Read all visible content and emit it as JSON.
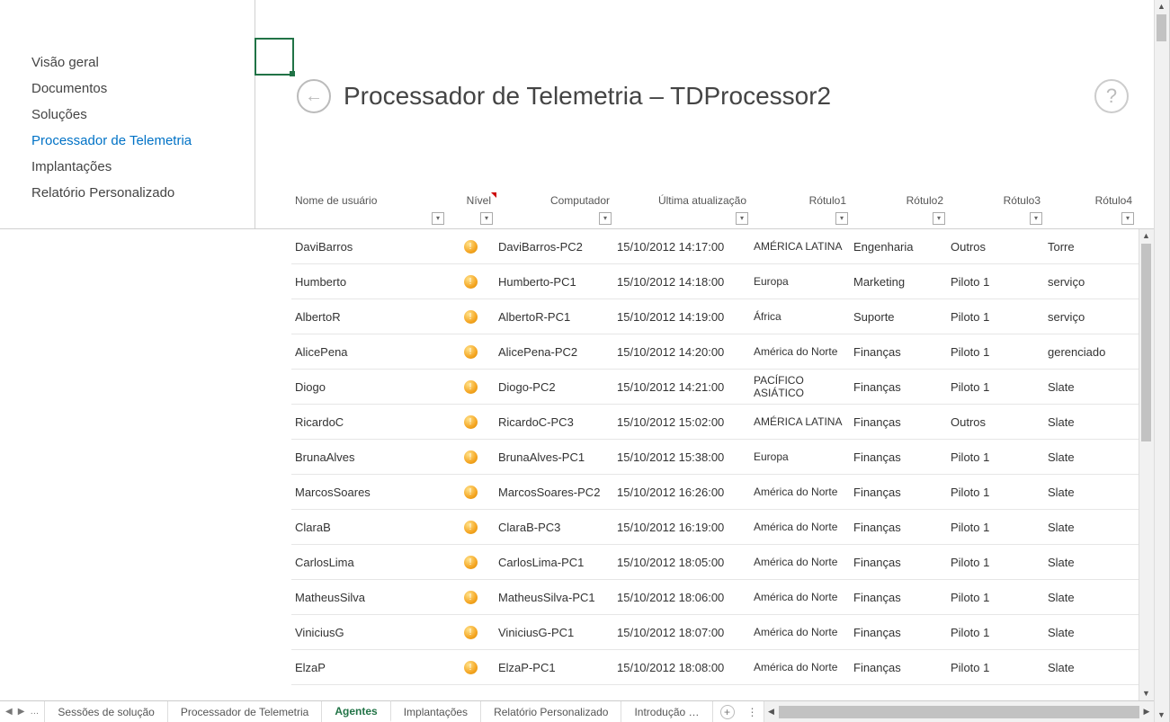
{
  "sidebar": {
    "items": [
      {
        "label": "Visão geral"
      },
      {
        "label": "Documentos"
      },
      {
        "label": "Soluções"
      },
      {
        "label": "Processador de Telemetria",
        "active": true
      },
      {
        "label": "Implantações"
      },
      {
        "label": "Relatório Personalizado"
      }
    ]
  },
  "header": {
    "title": "Processador de Telemetria – TDProcessor2"
  },
  "columns": [
    {
      "label": "Nome de usuário"
    },
    {
      "label": "Nível",
      "redmark": true
    },
    {
      "label": "Computador"
    },
    {
      "label": "Última atualização"
    },
    {
      "label": "Rótulo1"
    },
    {
      "label": "Rótulo2"
    },
    {
      "label": "Rótulo3"
    },
    {
      "label": "Rótulo4"
    }
  ],
  "rows": [
    {
      "user": "DaviBarros",
      "computer": "DaviBarros-PC2",
      "updated": "15/10/2012 14:17:00",
      "r1": "AMÉRICA LATINA",
      "r2": "Engenharia",
      "r3": "Outros",
      "r4": "Torre"
    },
    {
      "user": "Humberto",
      "computer": "Humberto-PC1",
      "updated": "15/10/2012 14:18:00",
      "r1": "Europa",
      "r2": "Marketing",
      "r3": "Piloto 1",
      "r4": "serviço"
    },
    {
      "user": "AlbertoR",
      "computer": "AlbertoR-PC1",
      "updated": "15/10/2012 14:19:00",
      "r1": "África",
      "r2": "Suporte",
      "r3": "Piloto 1",
      "r4": "serviço"
    },
    {
      "user": "AlicePena",
      "computer": "AlicePena-PC2",
      "updated": "15/10/2012 14:20:00",
      "r1": "América do Norte",
      "r2": "Finanças",
      "r3": "Piloto 1",
      "r4": "gerenciado"
    },
    {
      "user": "Diogo",
      "computer": "Diogo-PC2",
      "updated": "15/10/2012 14:21:00",
      "r1": "PACÍFICO ASIÁTICO",
      "r2": "Finanças",
      "r3": "Piloto 1",
      "r4": "Slate"
    },
    {
      "user": "RicardoC",
      "computer": "RicardoC-PC3",
      "updated": "15/10/2012 15:02:00",
      "r1": "AMÉRICA LATINA",
      "r2": "Finanças",
      "r3": "Outros",
      "r4": "Slate"
    },
    {
      "user": "BrunaAlves",
      "computer": "BrunaAlves-PC1",
      "updated": "15/10/2012 15:38:00",
      "r1": "Europa",
      "r2": "Finanças",
      "r3": "Piloto 1",
      "r4": "Slate"
    },
    {
      "user": "MarcosSoares",
      "computer": "MarcosSoares-PC2",
      "updated": "15/10/2012 16:26:00",
      "r1": "América do Norte",
      "r2": "Finanças",
      "r3": "Piloto 1",
      "r4": "Slate"
    },
    {
      "user": "ClaraB",
      "computer": "ClaraB-PC3",
      "updated": "15/10/2012 16:19:00",
      "r1": "América do Norte",
      "r2": "Finanças",
      "r3": "Piloto 1",
      "r4": "Slate"
    },
    {
      "user": "CarlosLima",
      "computer": "CarlosLima-PC1",
      "updated": "15/10/2012 18:05:00",
      "r1": "América do Norte",
      "r2": "Finanças",
      "r3": "Piloto 1",
      "r4": "Slate"
    },
    {
      "user": "MatheusSilva",
      "computer": "MatheusSilva-PC1",
      "updated": "15/10/2012 18:06:00",
      "r1": "América do Norte",
      "r2": "Finanças",
      "r3": "Piloto 1",
      "r4": "Slate"
    },
    {
      "user": "ViniciusG",
      "computer": "ViniciusG-PC1",
      "updated": "15/10/2012 18:07:00",
      "r1": "América do Norte",
      "r2": "Finanças",
      "r3": "Piloto 1",
      "r4": "Slate"
    },
    {
      "user": "ElzaP",
      "computer": "ElzaP-PC1",
      "updated": "15/10/2012 18:08:00",
      "r1": "América do Norte",
      "r2": "Finanças",
      "r3": "Piloto 1",
      "r4": "Slate"
    }
  ],
  "sheets": {
    "tabs": [
      {
        "label": "Sessões de solução"
      },
      {
        "label": "Processador de Telemetria"
      },
      {
        "label": "Agentes",
        "active": true
      },
      {
        "label": "Implantações"
      },
      {
        "label": "Relatório Personalizado"
      },
      {
        "label": "Introdução",
        "ellipsis": true
      }
    ]
  }
}
